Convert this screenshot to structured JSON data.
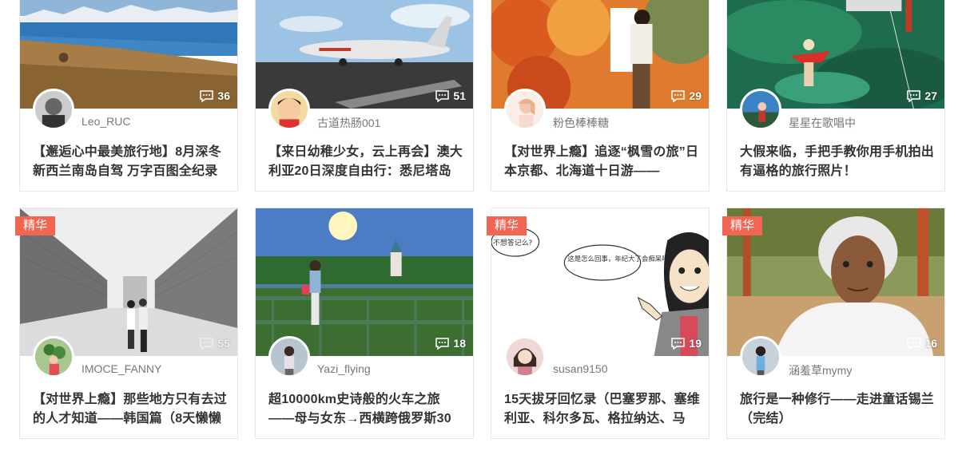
{
  "cards": [
    {
      "username": "Leo_RUC",
      "comments": "36",
      "badge": "",
      "title": "【邂逅心中最美旅行地】8月深冬新西兰南岛自驾 万字百图全纪录"
    },
    {
      "username": "古道热肠001",
      "comments": "51",
      "badge": "",
      "title": "【来日幼稚少女，云上再会】澳大利亚20日深度自由行：悉尼塔岛"
    },
    {
      "username": "粉色棒棒糖",
      "comments": "29",
      "badge": "",
      "title": "【对世界上瘾】追逐“枫雪の旅”日本京都、北海道十日游——"
    },
    {
      "username": "星星在歌唱中",
      "comments": "27",
      "badge": "",
      "title": "大假来临，手把手教你用手机拍出有逼格的旅行照片！"
    },
    {
      "username": "IMOCE_FANNY",
      "comments": "55",
      "badge": "精华",
      "title": "【对世界上瘾】那些地方只有去过的人才知道——韩国篇（8天懒懒"
    },
    {
      "username": "Yazi_flying",
      "comments": "18",
      "badge": "",
      "title": "超10000km史诗般的火车之旅——母与女东→西横跨俄罗斯30"
    },
    {
      "username": "susan9150",
      "comments": "19",
      "badge": "精华",
      "title": "15天拔牙回忆录（巴塞罗那、塞维利亚、科尔多瓦、格拉纳达、马"
    },
    {
      "username": "涵羞草mymy",
      "comments": "16",
      "badge": "精华",
      "title": "旅行是一种修行——走进童话锡兰（完结）"
    }
  ],
  "cartoon": {
    "bubble1": "不想答记么?",
    "bubble2": "这是怎么回事，年纪大了会痴呆吗？"
  },
  "icons": {
    "comment": "comment-icon"
  },
  "colors": {
    "badge": "#f26552",
    "title": "#333333",
    "username": "#777777"
  }
}
